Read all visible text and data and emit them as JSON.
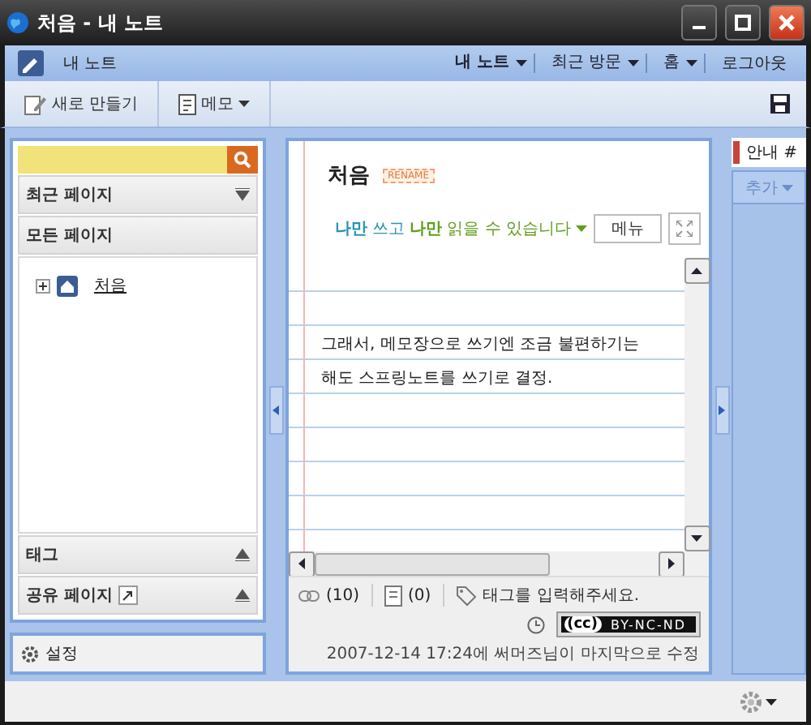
{
  "window": {
    "title": "처음 - 내 노트"
  },
  "nav": {
    "title": "내 노트",
    "menus": [
      {
        "label": "내 노트",
        "bold": true
      },
      {
        "label": "최근 방문",
        "bold": false
      },
      {
        "label": "홈",
        "bold": false
      }
    ],
    "logout": "로그아웃"
  },
  "toolbar": {
    "new_button": "새로 만들기",
    "memo_button": "메모"
  },
  "sidebar": {
    "top_sections": [
      {
        "label": "최근 페이지",
        "expanded": false
      },
      {
        "label": "모든 페이지",
        "expanded": true
      }
    ],
    "tree": [
      {
        "label": "처음",
        "expanded": false
      }
    ],
    "bottom_sections": [
      {
        "label": "태그",
        "shared": false
      },
      {
        "label": "공유 페이지",
        "shared": true
      }
    ],
    "settings": "설정"
  },
  "note": {
    "title": "처음",
    "rename": "RENAME",
    "access": [
      {
        "text": "**나만** 쓰고",
        "color": "#2a93b4"
      },
      {
        "text": "**나만** 읽을 수 있습니다",
        "color": "#5f9e1e"
      }
    ],
    "menu_button": "메뉴",
    "lines": [
      "그래서, 메모장으로 쓰기엔 조금 불편하기는",
      "해도 스프링노트를 쓰기로 결정."
    ],
    "links": "(10)",
    "attachments": "(0)",
    "tags": {
      "placeholder": "태그를 입력해주세요."
    },
    "license": {
      "cc": "(cc)",
      "terms": "BY-NC-ND"
    },
    "modified": "2007-12-14 17:24에 써머즈님이 마지막으로 수정"
  },
  "right_panel": {
    "tab": "안내 #",
    "add": "추가"
  }
}
